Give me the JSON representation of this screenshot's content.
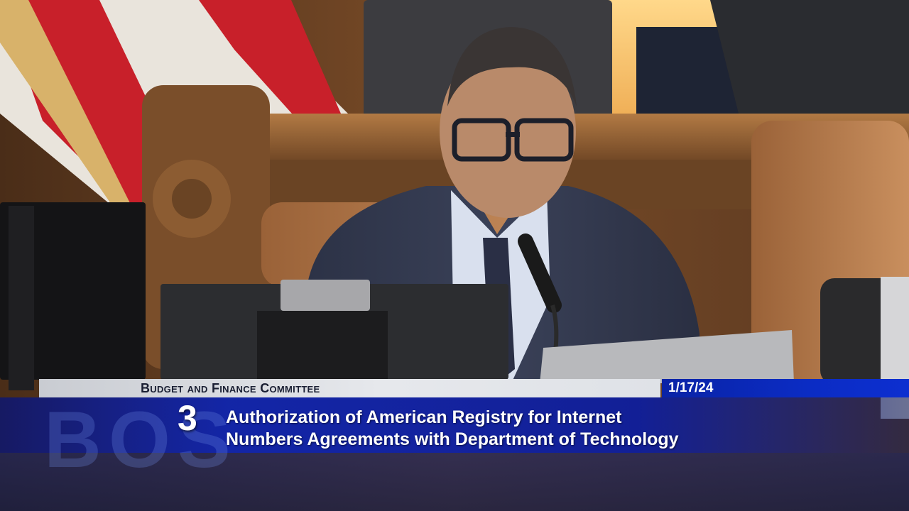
{
  "lower_third": {
    "committee": "Budget and Finance Committee",
    "date": "1/17/24",
    "watermark": "BOS",
    "item_number": "3",
    "item_title_line1": "Authorization of American Registry for Internet",
    "item_title_line2": "Numbers Agreements with Department of Technology"
  },
  "colors": {
    "accent_blue": "#0b2cc4",
    "strip_gray": "#dfe2e7",
    "wood": "#8a5a33",
    "flag_red": "#c8202a"
  }
}
